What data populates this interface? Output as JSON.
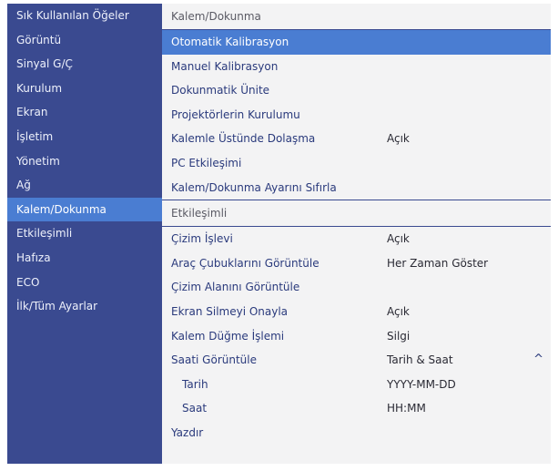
{
  "sidebar": {
    "items": [
      {
        "label": "Sık Kullanılan Öğeler"
      },
      {
        "label": "Görüntü"
      },
      {
        "label": "Sinyal G/Ç"
      },
      {
        "label": "Kurulum"
      },
      {
        "label": "Ekran"
      },
      {
        "label": "İşletim"
      },
      {
        "label": "Yönetim"
      },
      {
        "label": "Ağ"
      },
      {
        "label": "Kalem/Dokunma",
        "active": true
      },
      {
        "label": "Etkileşimli"
      },
      {
        "label": "Hafıza"
      },
      {
        "label": "ECO"
      },
      {
        "label": "İlk/Tüm Ayarlar"
      }
    ]
  },
  "main": {
    "section1": {
      "title": "Kalem/Dokunma",
      "rows": [
        {
          "label": "Otomatik Kalibrasyon",
          "value": "",
          "highlight": true
        },
        {
          "label": "Manuel Kalibrasyon",
          "value": ""
        },
        {
          "label": "Dokunmatik Ünite",
          "value": ""
        },
        {
          "label": "Projektörlerin Kurulumu",
          "value": ""
        },
        {
          "label": "Kalemle Üstünde Dolaşma",
          "value": "Açık"
        },
        {
          "label": "PC Etkileşimi",
          "value": ""
        },
        {
          "label": "Kalem/Dokunma Ayarını Sıfırla",
          "value": ""
        }
      ]
    },
    "section2": {
      "title": "Etkileşimli",
      "rows": [
        {
          "label": "Çizim İşlevi",
          "value": "Açık"
        },
        {
          "label": "Araç Çubuklarını Görüntüle",
          "value": "Her Zaman Göster"
        },
        {
          "label": "Çizim Alanını Görüntüle",
          "value": ""
        },
        {
          "label": "Ekran Silmeyi Onayla",
          "value": "Açık"
        },
        {
          "label": "Kalem Düğme İşlemi",
          "value": "Silgi"
        },
        {
          "label": "Saati Görüntüle",
          "value": "Tarih & Saat",
          "chevron": "^"
        },
        {
          "label": "Tarih",
          "value": "YYYY-MM-DD",
          "sub": true
        },
        {
          "label": "Saat",
          "value": "HH:MM",
          "sub": true
        },
        {
          "label": "Yazdır",
          "value": ""
        }
      ]
    }
  },
  "colors": {
    "sidebar_bg": "#3a4a90",
    "highlight": "#4a7dd2",
    "main_bg": "#f3f3f4",
    "label_text": "#2a3a7c"
  }
}
